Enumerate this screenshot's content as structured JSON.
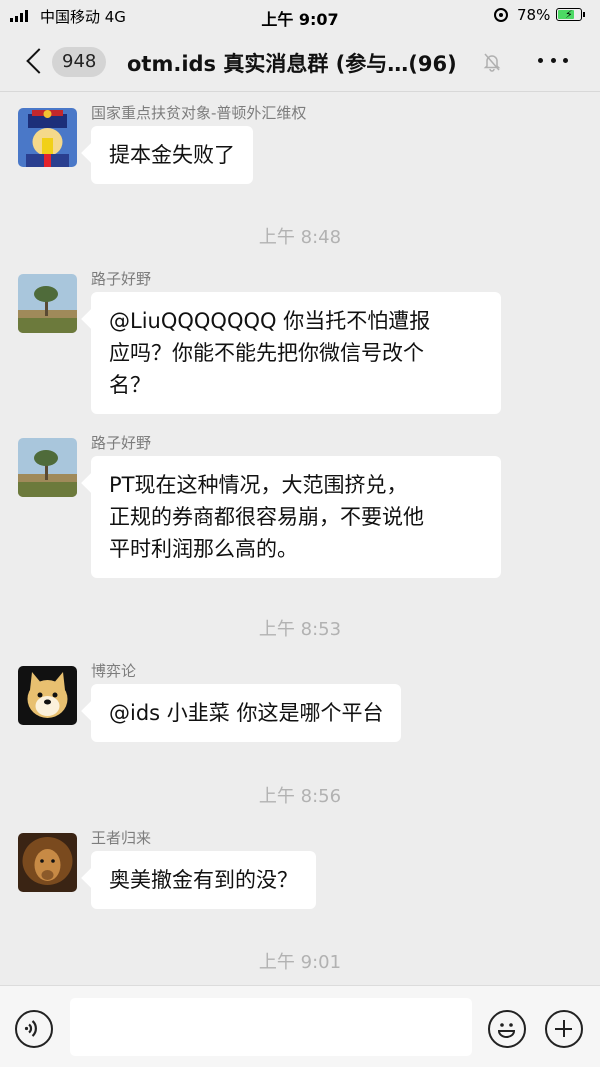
{
  "status_bar": {
    "carrier": "中国移动  4G",
    "time": "上午 9:07",
    "battery": "78%",
    "battery_level": 0.78
  },
  "nav": {
    "unread_count": "948",
    "title": "otm.ids 真实消息群 (参与…(96)",
    "icons": [
      "back-icon",
      "mute-bell-icon",
      "more-icon"
    ]
  },
  "messages": [
    {
      "sender": "国家重点扶贫对象-普顿外汇维权",
      "lines": [
        "提本金失败了"
      ],
      "avatar": "cartoon-official"
    },
    {
      "time": "上午 8:48"
    },
    {
      "sender": "路子好野",
      "lines": [
        "@LiuQQQQQQQ 你当托不怕遭报",
        "应吗？你能不能先把你微信号改个",
        "名？"
      ],
      "avatar": "landscape-tree"
    },
    {
      "sender": "路子好野",
      "lines": [
        "PT现在这种情况，大范围挤兑，",
        "正规的券商都很容易崩，不要说他",
        "平时利润那么高的。"
      ],
      "avatar": "landscape-tree"
    },
    {
      "time": "上午 8:53"
    },
    {
      "sender": "博弈论",
      "lines": [
        "@ids 小韭菜 你这是哪个平台"
      ],
      "avatar": "doge"
    },
    {
      "time": "上午 8:56"
    },
    {
      "sender": "王者归来",
      "lines": [
        "奥美撤金有到的没？"
      ],
      "avatar": "lion"
    },
    {
      "time": "上午 9:01"
    }
  ],
  "input_bar": {
    "icons": [
      "voice-icon",
      "emoji-icon",
      "plus-icon"
    ]
  }
}
